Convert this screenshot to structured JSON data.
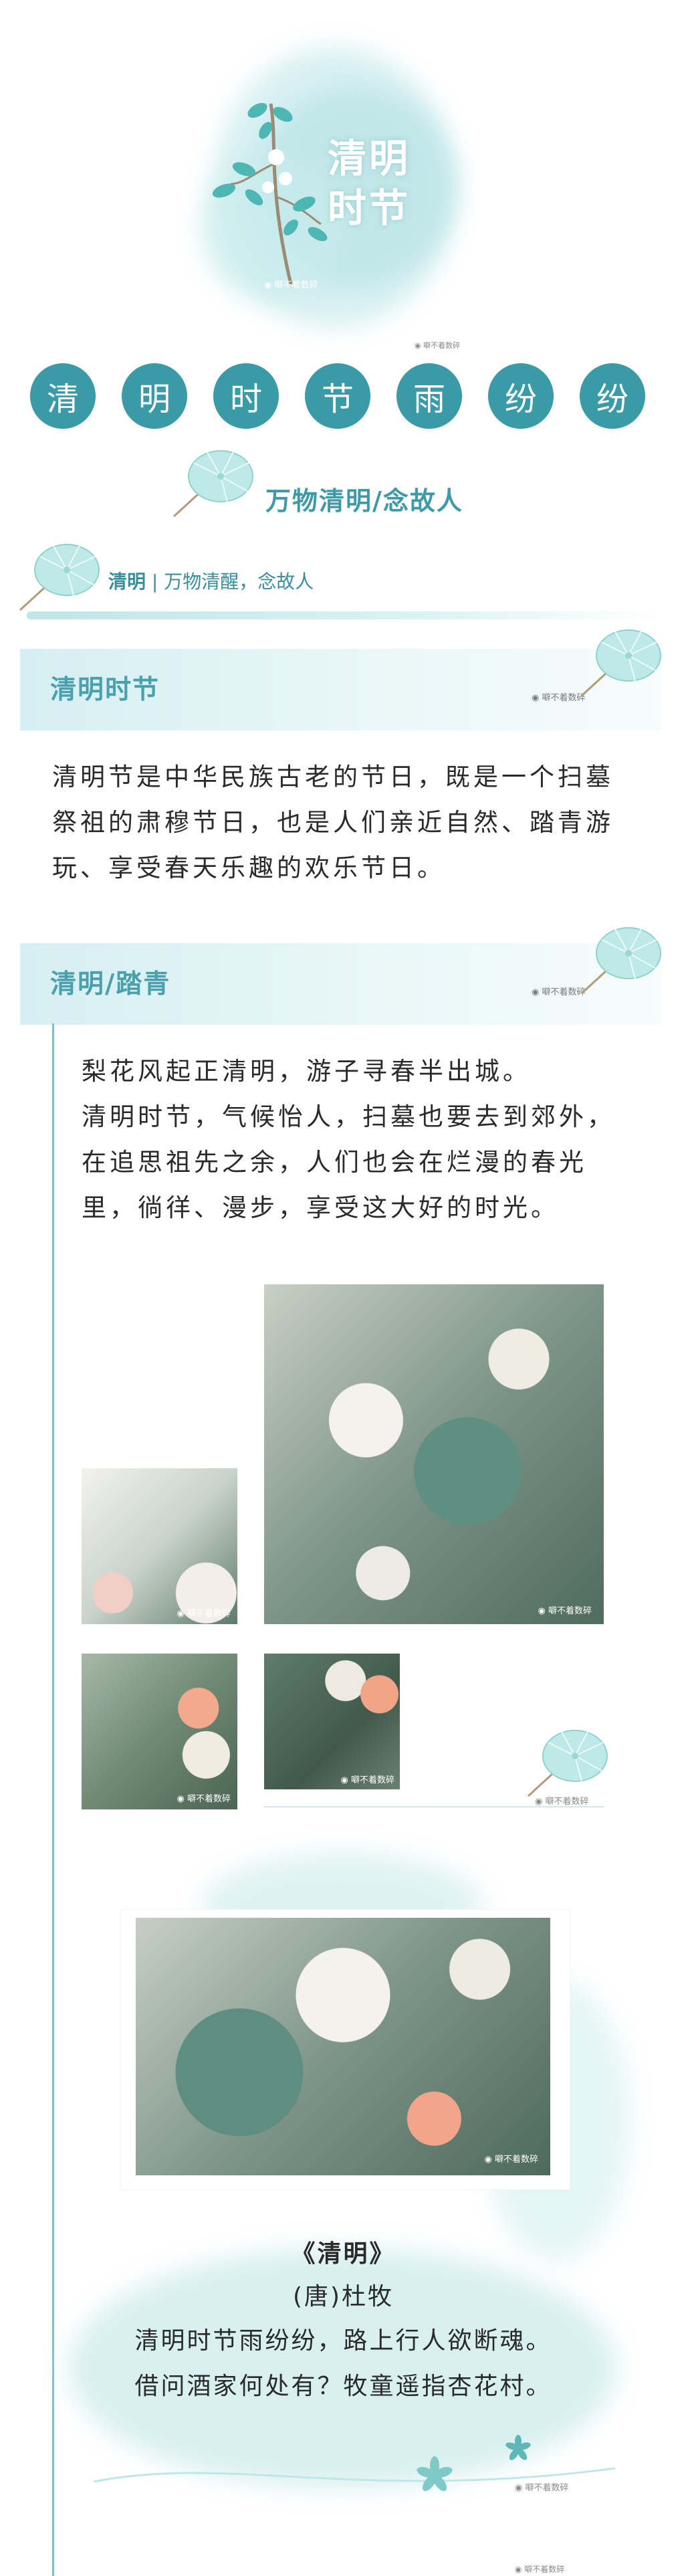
{
  "header": {
    "title_line1": "清明",
    "title_line2": "时节",
    "watermark": "噼不着数碎",
    "watermark_small": "噼不着数碎"
  },
  "circles": [
    "清",
    "明",
    "时",
    "节",
    "雨",
    "纷",
    "纷"
  ],
  "subtitle": "万物清明/念故人",
  "tagline": {
    "strong": "清明",
    "rest": " | 万物清醒，念故人"
  },
  "section1": {
    "title": "清明时节",
    "watermark": "噼不着数碎",
    "paragraph": "清明节是中华民族古老的节日，既是一个扫墓祭祖的肃穆节日，也是人们亲近自然、踏青游玩、享受春天乐趣的欢乐节日。"
  },
  "section2": {
    "title": "清明/踏青",
    "watermark": "噼不着数碎",
    "line1": "梨花风起正清明，游子寻春半出城。",
    "paragraph": "清明时节，气候怡人，扫墓也要去到郊外，在追思祖先之余，人们也会在烂漫的春光里，徜徉、漫步，享受这大好的时光。",
    "photo_watermark": "噼不着数碎"
  },
  "poem": {
    "title": "《清明》",
    "author": "(唐)杜牧",
    "line1": "清明时节雨纷纷，路上行人欲断魂。",
    "line2": "借问酒家何处有？牧童遥指杏花村。",
    "watermark": "噼不着数碎",
    "footer_watermark": "噼不着数碎"
  },
  "colors": {
    "accent": "#3a9aa6",
    "title": "#4aa0ad",
    "wash": "#bfe6e8",
    "text": "#2a2a2a"
  },
  "icons": [
    "umbrella-icon",
    "branch-icon",
    "flower-icon",
    "wechat-icon"
  ]
}
